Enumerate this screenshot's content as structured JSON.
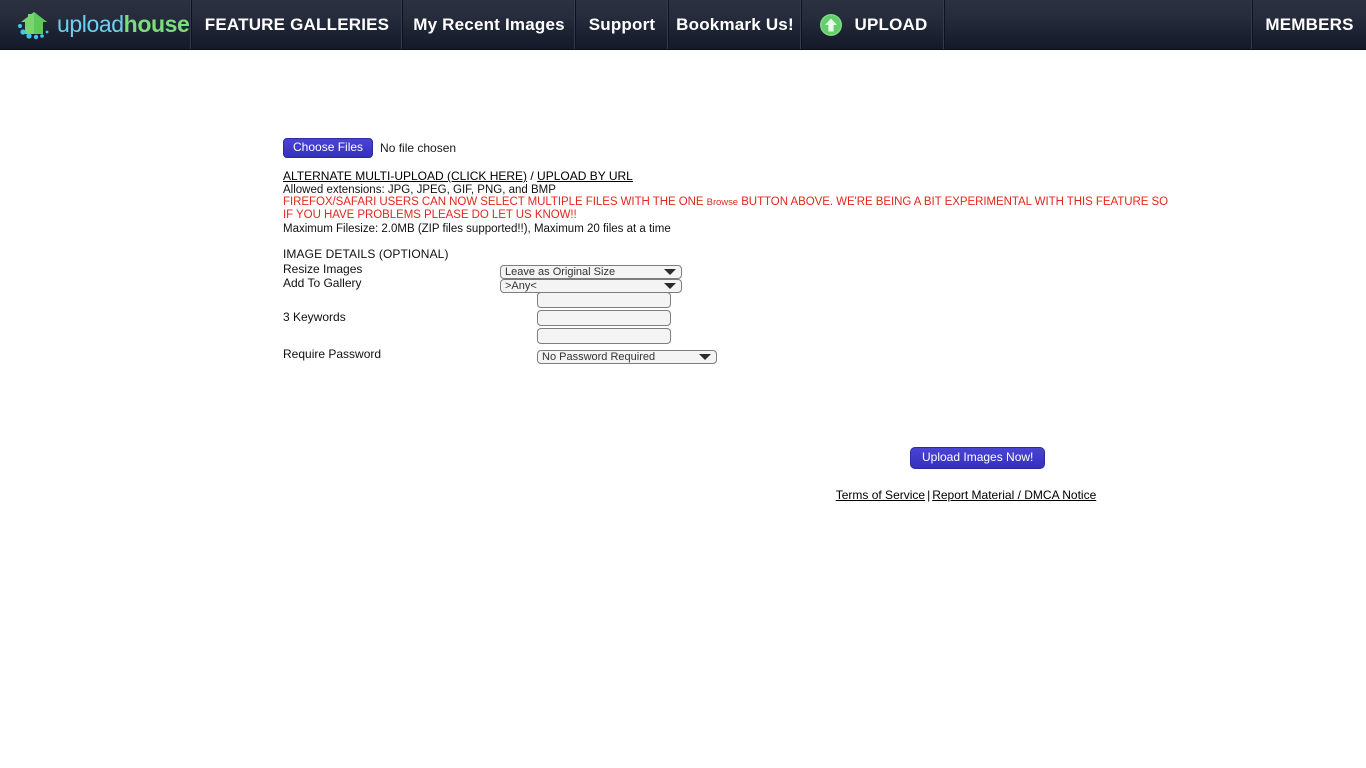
{
  "colors": {
    "nav_bg_top": "#2b3141",
    "nav_bg_bottom": "#141a28",
    "accent_button": "#3b35c6",
    "warning_red": "#e0281f",
    "logo_upload": "#6fd0ee",
    "logo_house": "#7ddc7d",
    "upload_icon_green": "#7ddc7d"
  },
  "nav": {
    "logo": {
      "icon": "house-logo-icon",
      "text_part1": "upload",
      "text_part2": "house"
    },
    "items": [
      {
        "label": "FEATURE GALLERIES",
        "name": "nav-feature-galleries"
      },
      {
        "label": "My Recent Images",
        "name": "nav-my-recent-images"
      },
      {
        "label": "Support",
        "name": "nav-support"
      },
      {
        "label": "Bookmark Us!",
        "name": "nav-bookmark-us"
      },
      {
        "label": "UPLOAD",
        "name": "nav-upload",
        "icon": "upload-arrow-icon"
      }
    ],
    "members_label": "MEMBERS"
  },
  "upload_form": {
    "choose_files_label": "Choose Files",
    "file_status": "No file chosen",
    "alternate_link": "ALTERNATE MULTI-UPLOAD (CLICK HERE)",
    "link_separator": " / ",
    "url_link": "UPLOAD BY URL",
    "allowed_extensions": "Allowed extensions: JPG, JPEG, GIF, PNG, and BMP",
    "warning_line1_a": "FIREFOX/SAFARI USERS CAN NOW SELECT MULTIPLE FILES WITH THE ONE ",
    "warning_line1_browse": "Browse",
    "warning_line1_b": " BUTTON ABOVE. WE'RE BEING A BIT EXPERIMENTAL WITH THIS FEATURE SO",
    "warning_line2": "IF YOU HAVE PROBLEMS PLEASE DO LET US KNOW!!",
    "filesize_note": "Maximum Filesize: 2.0MB (ZIP files supported!!), Maximum 20 files at a time",
    "details_heading": "IMAGE DETAILS (OPTIONAL)",
    "resize_label": "Resize Images",
    "resize_value": "Leave as Original Size",
    "gallery_label": "Add To Gallery",
    "gallery_value": ">Any<",
    "keywords_label": "3 Keywords",
    "keyword1_value": "",
    "keyword2_value": "",
    "keyword3_value": "",
    "password_label": "Require Password",
    "password_value": "No Password Required",
    "submit_label": "Upload Images Now!"
  },
  "footer": {
    "terms_label": "Terms of Service",
    "separator": "|",
    "dmca_label": "Report Material / DMCA Notice"
  }
}
